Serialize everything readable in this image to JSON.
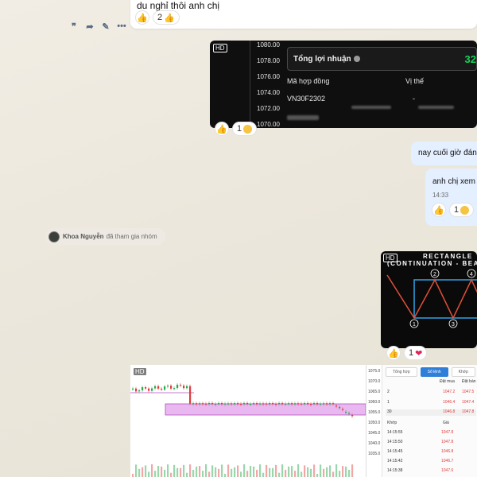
{
  "top_message": {
    "text": "du nghỉ thôi anh chị",
    "reaction_count": "2"
  },
  "message_actions": {
    "quote_icon": "quote-icon",
    "forward_icon": "share-icon",
    "edit_icon": "edit-icon",
    "more_icon": "more-icon"
  },
  "dark_card": {
    "badge": "HD",
    "prices": [
      "1080.00",
      "1078.00",
      "1076.00",
      "1074.00",
      "1072.00",
      "1070.00"
    ],
    "profit_label": "Tổng lợi nhuận",
    "profit_value": "32",
    "col_contract": "Mã hợp đồng",
    "col_position": "Vị thế",
    "row_contract": "VN30F2302",
    "row_position": "-",
    "reaction_count": "1"
  },
  "right_messages": {
    "msg1": "nay cuối giờ đánh",
    "msg2": "anh chị xem t",
    "time": "14:33",
    "reaction_count": "1"
  },
  "system_notice": {
    "name": "Khoa Nguyễn",
    "action": "đã tham gia nhóm"
  },
  "pattern_card": {
    "badge": "HD",
    "title_line1": "RECTANGLE",
    "title_line2": "(CONTINUATION - BEARI",
    "points": [
      "1",
      "2",
      "3",
      "4"
    ],
    "reaction_count": "1"
  },
  "trade_card": {
    "badge": "HD",
    "axis": [
      "1075.0",
      "1070.0",
      "1065.0",
      "1060.0",
      "1055.0",
      "1050.0",
      "1045.0",
      "1040.0",
      "1035.0"
    ],
    "tabs": [
      "Tổng hợp",
      "Sổ lệnh",
      "Khớp"
    ],
    "head_buy": "Đặt mua",
    "head_sell": "Đặt bán",
    "book": [
      {
        "qty": "2",
        "buy": "1047.2"
      },
      {
        "qty": "1",
        "buy": "1046.4"
      },
      {
        "qty": "30",
        "buy": "1046.8"
      }
    ],
    "book_sell": [
      "1047.5",
      "1047.4",
      "1047.8"
    ],
    "match_label": "Khớp",
    "price_label": "Giá",
    "trades": [
      {
        "time": "14:15:55",
        "price": "1047.8"
      },
      {
        "time": "14:15:50",
        "price": "1047.8"
      },
      {
        "time": "14:15:45",
        "price": "1046.8"
      },
      {
        "time": "14:15:42",
        "price": "1046.7"
      },
      {
        "time": "14:15:38",
        "price": "1047.6"
      }
    ],
    "colors": {
      "up": "#2aa84a",
      "down": "#e03b3b",
      "zone": "#e9b8f0"
    }
  }
}
